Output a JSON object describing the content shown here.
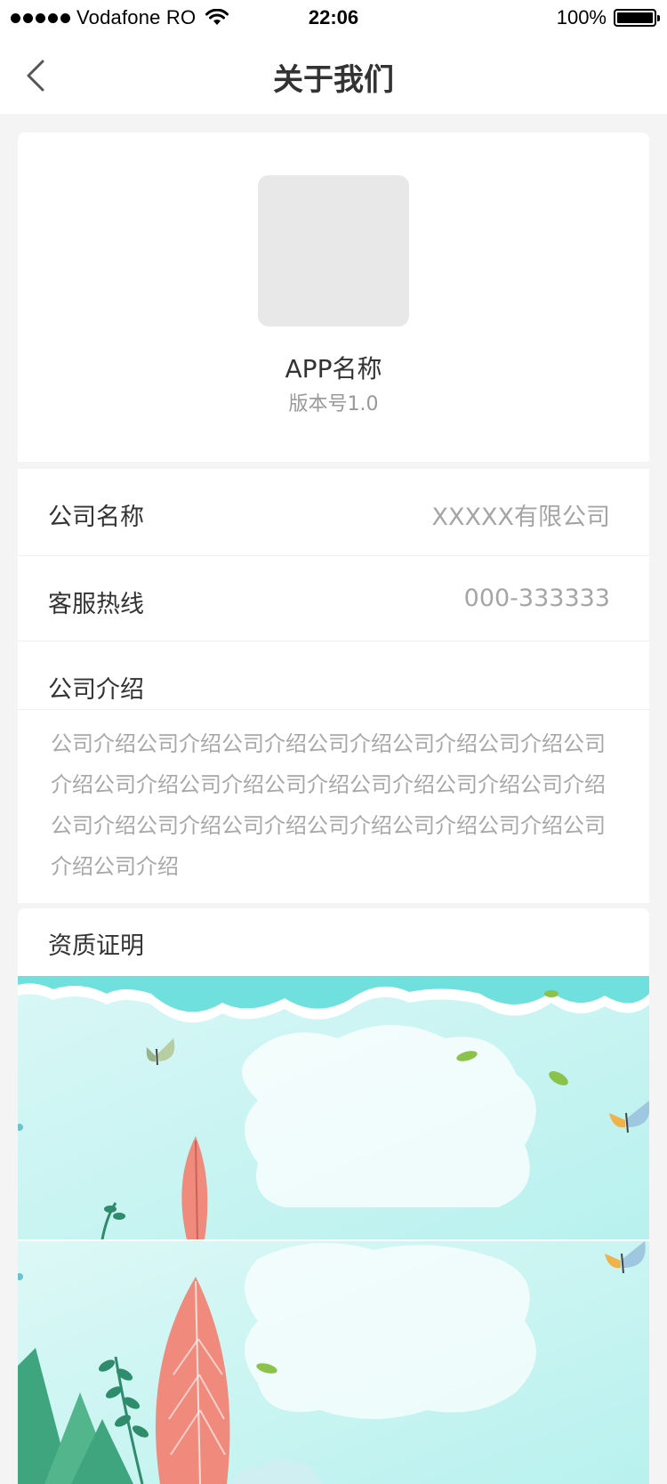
{
  "status_bar": {
    "carrier": "Vodafone RO",
    "time": "22:06",
    "battery": "100%",
    "battery_level": 1.0,
    "icons": [
      "signal-dots-icon",
      "wifi-icon",
      "battery-icon"
    ]
  },
  "nav": {
    "title": "关于我们",
    "back_icon": "chevron-left-icon"
  },
  "app": {
    "name": "APP名称",
    "version": "版本号1.0",
    "icon": "app-icon-placeholder"
  },
  "info": {
    "company_label": "公司名称",
    "company_value": "XXXXX有限公司",
    "hotline_label": "客服热线",
    "hotline_value": "000-333333",
    "intro_label": "公司介绍",
    "intro_text": "公司介绍公司介绍公司介绍公司介绍公司介绍公司介绍公司介绍公司介绍公司介绍公司介绍公司介绍公司介绍公司介绍公司介绍公司介绍公司介绍公司介绍公司介绍公司介绍公司介绍公司介绍"
  },
  "qualification": {
    "title": "资质证明",
    "images": [
      "qualification-image-1",
      "qualification-image-2"
    ]
  },
  "colors": {
    "background": "#f4f4f4",
    "card": "#ffffff",
    "text_primary": "#333333",
    "text_secondary": "#a5a5a5",
    "image_teal": "#bff4f0"
  }
}
